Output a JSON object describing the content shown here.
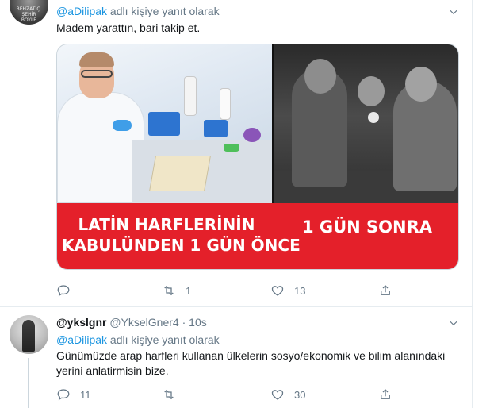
{
  "tweet1": {
    "reply_prefix_handle": "@aDilipak",
    "reply_suffix": " adlı kişiye yanıt olarak",
    "text": "Madem yarattın, bari takip et.",
    "avatar_text": "BEHZAT Ç. ŞEHİR BÖYLE",
    "media": {
      "left_caption_line1": "LATİN HARFLERİNİN",
      "left_caption_line2": "KABULÜNDEN 1 GÜN ÖNCE",
      "right_caption": "1 GÜN SONRA",
      "banner_color": "#e4202a"
    },
    "actions": {
      "reply_count": "",
      "retweet_count": "1",
      "like_count": "13"
    }
  },
  "tweet2": {
    "display_name": "@ykslgnr",
    "screen_name": " @YkselGner4",
    "separator": " · ",
    "time": "10s",
    "reply_prefix_handle": "@aDilipak",
    "reply_suffix": " adlı kişiye yanıt olarak",
    "text": "Günümüzde arap harfleri kullanan ülkelerin sosyo/ekonomik ve bilim alanındaki yerini anlatirmisin bize.",
    "actions": {
      "reply_count": "11",
      "retweet_count": "",
      "like_count": "30"
    }
  },
  "colors": {
    "link": "#1b95e0",
    "secondary_text": "#657786",
    "primary_text": "#14171a",
    "border": "#e6ecf0"
  },
  "icons": {
    "reply": "reply-icon",
    "retweet": "retweet-icon",
    "like": "heart-icon",
    "share": "share-icon",
    "more": "chevron-down-icon"
  }
}
